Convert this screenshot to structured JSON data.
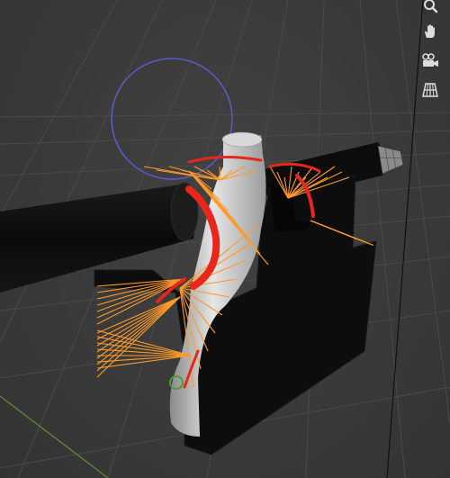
{
  "viewport": {
    "background": "#3a3a3a",
    "grid_color": "#4a4a4a",
    "x_axis_color": "#9a3a3a",
    "y_axis_color": "#6a8a3a"
  },
  "navigation_gizmo": {
    "buttons": [
      {
        "name": "zoom-view-button",
        "icon": "magnifier-icon"
      },
      {
        "name": "pan-view-button",
        "icon": "hand-icon"
      },
      {
        "name": "camera-view-button",
        "icon": "camera-icon"
      },
      {
        "name": "perspective-toggle-button",
        "icon": "grid-icon"
      }
    ]
  },
  "scene_objects": {
    "rotation_circle_color": "#5a5acf",
    "mesh_color": "#bfbfbf",
    "rig_lines_color": "#ff9a2a",
    "rig_curve_color": "#e8261a",
    "cylinder_color": "#0d0d0d"
  }
}
